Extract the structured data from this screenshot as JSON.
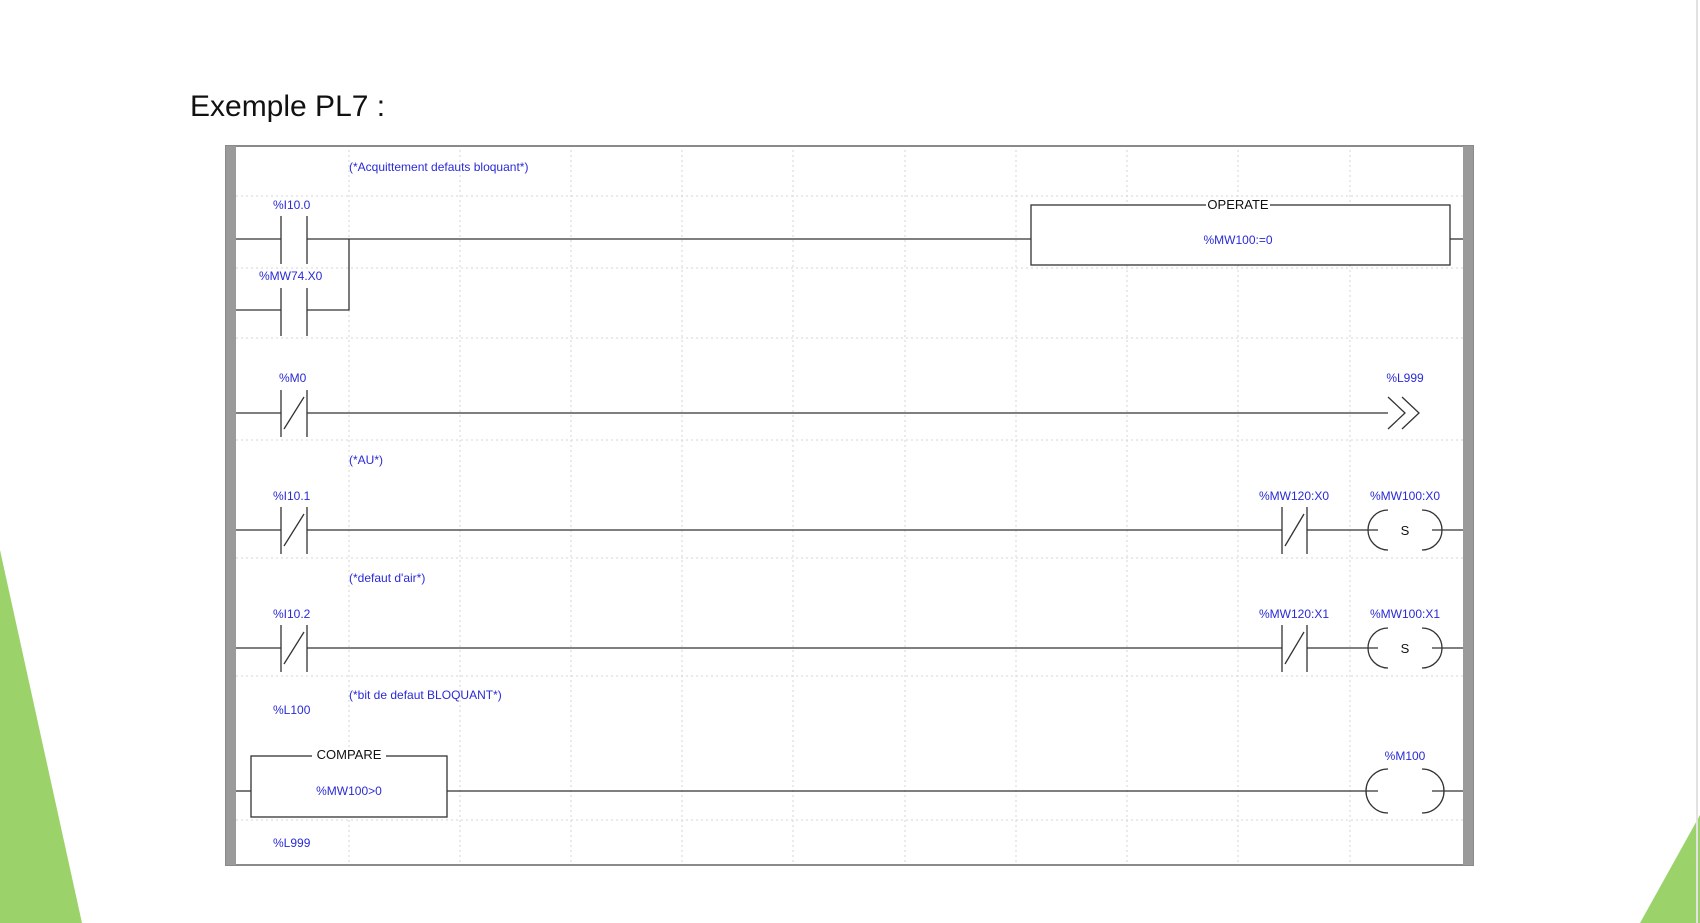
{
  "slide": {
    "title": "Exemple PL7 :",
    "accent_color": "#9bd36a"
  },
  "ladder": {
    "rung1": {
      "comment": "(*Acquittement defauts bloquant*)",
      "contact1": "%I10.0",
      "contact2": "%MW74.X0",
      "block_title": "OPERATE",
      "block_expr": "%MW100:=0"
    },
    "rung2": {
      "contact": "%M0",
      "jump_label": "%L999"
    },
    "rung3": {
      "comment": "(*AU*)",
      "contact": "%I10.1",
      "contact_right": "%MW120:X0",
      "coil_label": "%MW100:X0",
      "coil_type": "S"
    },
    "rung4": {
      "comment": "(*defaut d'air*)",
      "contact": "%I10.2",
      "contact_right": "%MW120:X1",
      "coil_label": "%MW100:X1",
      "coil_type": "S"
    },
    "rung5": {
      "comment": "(*bit de defaut BLOQUANT*)",
      "label": "%L100",
      "block_title": "COMPARE",
      "block_expr": "%MW100>0",
      "coil_label": "%M100"
    },
    "rung6": {
      "label": "%L999"
    }
  }
}
